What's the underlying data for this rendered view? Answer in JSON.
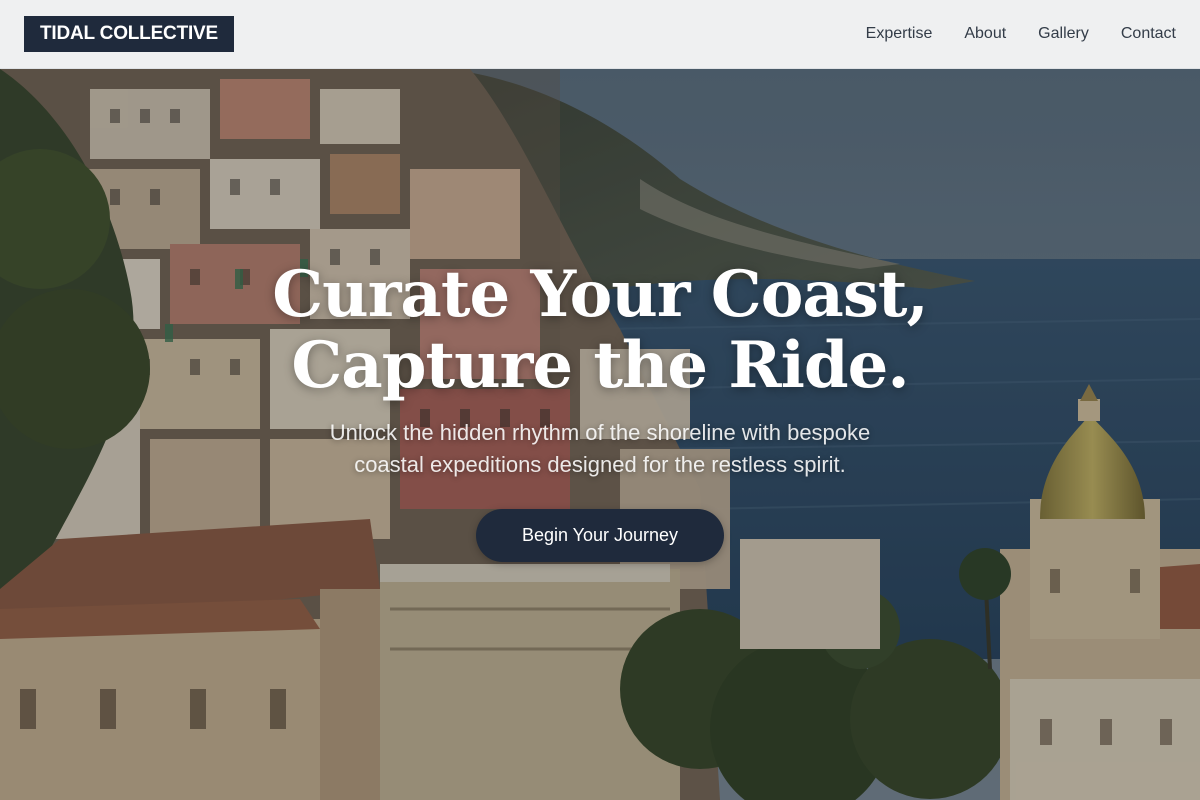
{
  "brand": {
    "name": "TIDAL COLLECTIVE"
  },
  "nav": {
    "items": [
      {
        "label": "Expertise"
      },
      {
        "label": "About"
      },
      {
        "label": "Gallery"
      },
      {
        "label": "Contact"
      }
    ]
  },
  "hero": {
    "title_line_1": "Curate Your Coast,",
    "title_line_2": "Capture the Ride.",
    "subtitle_line_1": "Unlock the hidden rhythm of the shoreline with bespoke",
    "subtitle_line_2": "coastal expeditions designed for the restless spirit.",
    "cta_label": "Begin Your Journey",
    "background_image": "coastal-hillside-village-photo"
  },
  "colors": {
    "brand_navy": "#1f2a3c",
    "header_bg": "#f6f7f8",
    "nav_text": "#333c48",
    "hero_text": "#ffffff"
  }
}
